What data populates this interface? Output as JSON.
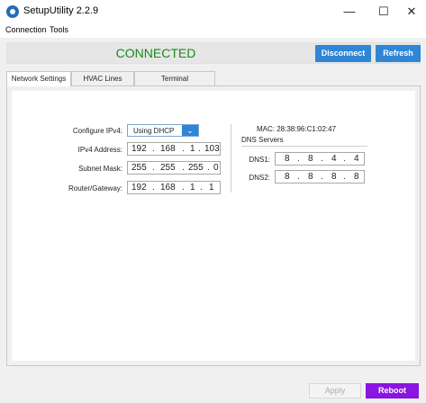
{
  "window": {
    "title": "SetupUtility 2.2.9",
    "minimize_glyph": "—",
    "maximize_glyph": "☐",
    "close_glyph": "✕"
  },
  "menu": {
    "items": [
      "Connection",
      "Tools"
    ]
  },
  "status": {
    "text": "CONNECTED",
    "color": "#1b8a1b",
    "disconnect_label": "Disconnect",
    "refresh_label": "Refresh"
  },
  "tabs": [
    {
      "label": "Network Settings",
      "active": true
    },
    {
      "label": "HVAC Lines",
      "active": false
    },
    {
      "label": "Terminal",
      "active": false
    }
  ],
  "network": {
    "configure_label": "Configure IPv4:",
    "configure_value": "Using DHCP",
    "ipv4_label": "IPv4 Address:",
    "ipv4": [
      "192",
      "168",
      "1",
      "103"
    ],
    "subnet_label": "Subnet Mask:",
    "subnet": [
      "255",
      "255",
      "255",
      "0"
    ],
    "router_label": "Router/Gateway:",
    "router": [
      "192",
      "168",
      "1",
      "1"
    ]
  },
  "dns": {
    "mac": "MAC: 28:38:96:C1:02:47",
    "title": "DNS Servers",
    "dns1_label": "DNS1:",
    "dns1": [
      "8",
      "8",
      "4",
      "4"
    ],
    "dns2_label": "DNS2:",
    "dns2": [
      "8",
      "8",
      "8",
      "8"
    ]
  },
  "actions": {
    "apply_label": "Apply",
    "reboot_label": "Reboot",
    "accent_blue": "#2f86d4",
    "accent_purple": "#8a14e0"
  }
}
